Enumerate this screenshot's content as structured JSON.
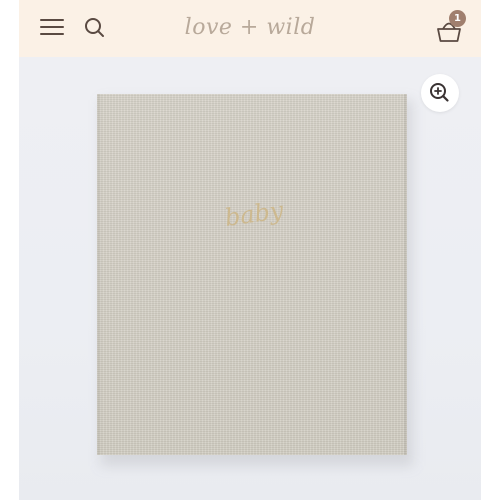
{
  "header": {
    "logo_text": "love + wild",
    "menu_icon": "hamburger-menu-icon",
    "search_icon": "search-icon",
    "cart_icon": "basket-icon",
    "cart_count": "1",
    "background_color": "#fbf1e6",
    "icon_color": "#5a4a42",
    "badge_color": "#a07f6e"
  },
  "product_gallery": {
    "zoom_icon": "zoom-in-icon",
    "book_cover_text": "baby",
    "book_color": "#d3cfc4",
    "foil_color": "#cdb78a"
  }
}
